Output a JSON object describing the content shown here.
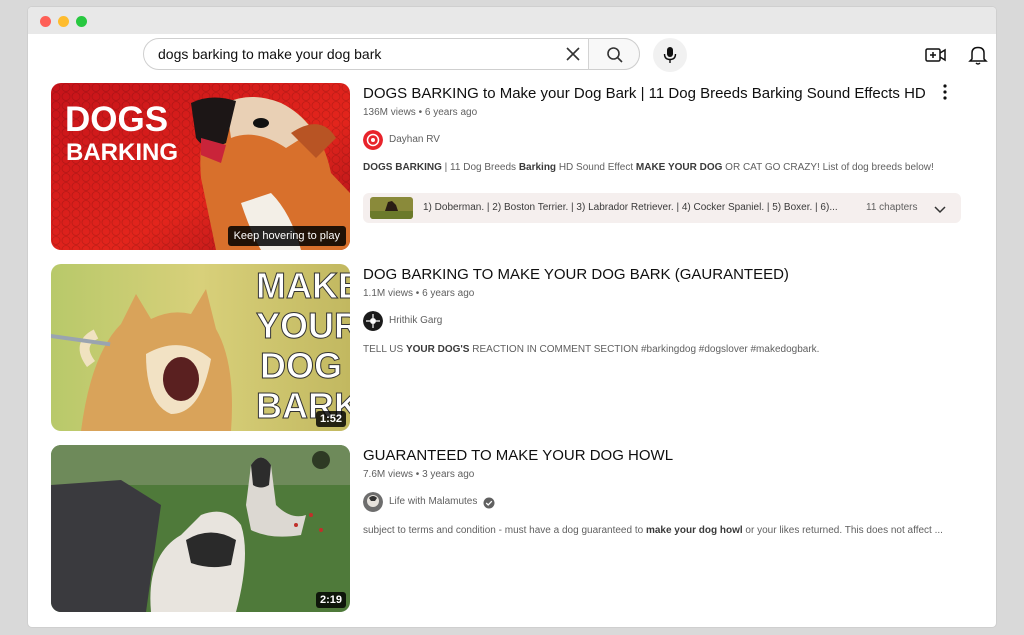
{
  "search": {
    "query": "dogs barking to make your dog bark"
  },
  "header": {
    "clear_icon": "close-icon",
    "search_icon": "search-icon",
    "mic_icon": "microphone-icon",
    "create_icon": "video-camera-plus-icon",
    "bell_icon": "bell-icon"
  },
  "results": [
    {
      "title": "DOGS BARKING to Make your Dog Bark | 11 Dog Breeds Barking Sound Effects HD",
      "views": "136M views",
      "age": "6 years ago",
      "channel": "Dayhan RV",
      "thumb_text_1": "DOGS",
      "thumb_text_2": "BARKING",
      "hover_hint": "Keep hovering to play",
      "desc": {
        "p1": "DOGS BARKING",
        "p2": " | 11 Dog Breeds ",
        "p3": "Barking",
        "p4": " HD Sound Effect ",
        "p5": "MAKE YOUR DOG",
        "p6": " OR CAT GO CRAZY! List of dog breeds below!"
      },
      "chapters_text": "1) Doberman. | 2) Boston Terrier. | 3) Labrador Retriever. | 4) Cocker Spaniel. | 5) Boxer. | 6)...",
      "chapters_count": "11 chapters",
      "accent": "#e0201a"
    },
    {
      "title": "DOG BARKING TO MAKE YOUR DOG BARK (GAURANTEED)",
      "views": "1.1M views",
      "age": "6 years ago",
      "channel": "Hrithik Garg",
      "thumb_text": [
        "MAKE",
        "YOUR",
        "DOG",
        "BARK"
      ],
      "duration": "1:52",
      "desc": {
        "p1": "TELL US ",
        "p2": "YOUR DOG'S",
        "p3": " REACTION IN COMMENT SECTION #barkingdog #dogslover #makedogbark."
      }
    },
    {
      "title": "GUARANTEED TO MAKE YOUR DOG HOWL",
      "views": "7.6M views",
      "age": "3 years ago",
      "channel": "Life with Malamutes",
      "verified_icon": "verified-check-icon",
      "duration": "2:19",
      "desc": {
        "p1": "subject to terms and condition - must have a dog guaranteed to ",
        "p2": "make your dog howl",
        "p3": " or your likes returned. This does not affect ..."
      }
    }
  ],
  "separator": " • "
}
